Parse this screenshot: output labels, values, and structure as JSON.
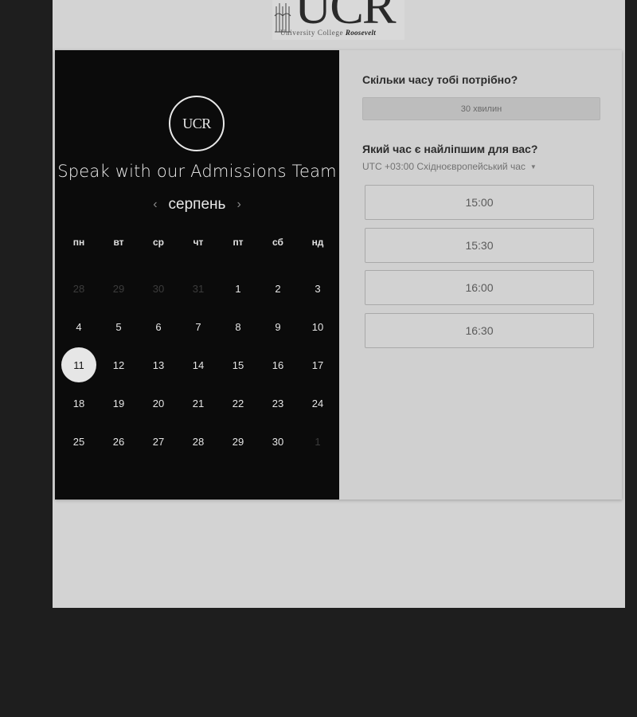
{
  "header": {
    "logo_text": "UCR",
    "logo_subtitle": "University College",
    "logo_subtitle_em": "Roosevelt"
  },
  "calendar": {
    "logo_text": "UCR",
    "title": "Speak with our Admissions Team",
    "month": "серпень",
    "prev_label": "‹",
    "next_label": "›",
    "weekdays": [
      "пн",
      "вт",
      "ср",
      "чт",
      "пт",
      "сб",
      "нд"
    ],
    "weeks": [
      [
        {
          "d": "28",
          "muted": true
        },
        {
          "d": "29",
          "muted": true
        },
        {
          "d": "30",
          "muted": true
        },
        {
          "d": "31",
          "muted": true
        },
        {
          "d": "1"
        },
        {
          "d": "2"
        },
        {
          "d": "3"
        }
      ],
      [
        {
          "d": "4"
        },
        {
          "d": "5"
        },
        {
          "d": "6"
        },
        {
          "d": "7"
        },
        {
          "d": "8"
        },
        {
          "d": "9"
        },
        {
          "d": "10"
        }
      ],
      [
        {
          "d": "11",
          "selected": true
        },
        {
          "d": "12"
        },
        {
          "d": "13"
        },
        {
          "d": "14"
        },
        {
          "d": "15"
        },
        {
          "d": "16"
        },
        {
          "d": "17"
        }
      ],
      [
        {
          "d": "18"
        },
        {
          "d": "19"
        },
        {
          "d": "20"
        },
        {
          "d": "21"
        },
        {
          "d": "22"
        },
        {
          "d": "23"
        },
        {
          "d": "24"
        }
      ],
      [
        {
          "d": "25"
        },
        {
          "d": "26"
        },
        {
          "d": "27"
        },
        {
          "d": "28"
        },
        {
          "d": "29"
        },
        {
          "d": "30"
        },
        {
          "d": "1",
          "muted": true
        }
      ]
    ]
  },
  "booking": {
    "duration_question": "Скільки часу тобі потрібно?",
    "duration_value": "30 хвилин",
    "time_question": "Який час є найліпшим для вас?",
    "timezone": "UTC +03:00 Східноєвропейський час",
    "slots": [
      "15:00",
      "15:30",
      "16:00",
      "16:30"
    ]
  }
}
